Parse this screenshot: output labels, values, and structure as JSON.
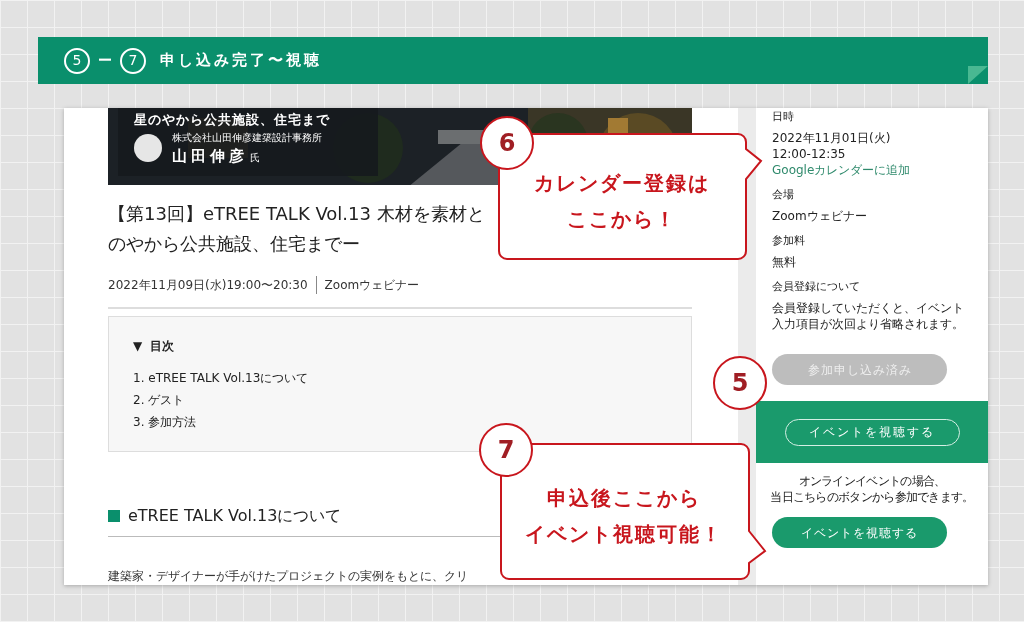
{
  "section_header": {
    "step_from": "5",
    "dash": "ー",
    "step_to": "7",
    "title": "申し込み完了〜視聴"
  },
  "hero": {
    "subtitle": "星のやから公共施設、住宅まで",
    "company": "株式会社山田伸彦建築設計事務所",
    "speaker": "山田伸彦",
    "honorific": "氏"
  },
  "event": {
    "title_lines": [
      "【第13回】eTREE TALK Vol.13 木材を素材と",
      "のやから公共施設、住宅までー"
    ],
    "date": "2022年11月09日(水)19:00〜20:30",
    "venue": "Zoomウェビナー"
  },
  "toc": {
    "toggle": "▼",
    "heading": "目次",
    "items": [
      "1. eTREE TALK Vol.13について",
      "2. ゲスト",
      "3. 参加方法"
    ]
  },
  "section_heading": "eTREE TALK Vol.13について",
  "body_text": "建築家・デザイナーが手がけたプロジェクトの実例をもとに、クリ",
  "sidebar": {
    "details": [
      {
        "label": "日時",
        "lines": [
          "2022年11月01日(火)",
          "12:00-12:35"
        ],
        "link": "Googleカレンダーに追加"
      },
      {
        "label": "会場",
        "lines": [
          "Zoomウェビナー"
        ]
      },
      {
        "label": "参加料",
        "lines": [
          "無料"
        ]
      },
      {
        "label": "会員登録について",
        "lines": [
          "会員登録していただくと、イベント",
          "入力項目が次回より省略されます。"
        ]
      }
    ],
    "applied_button": {
      "label": "参加申し込み済み",
      "disabled": true
    },
    "panel_button": "イベントを視聴する",
    "note_lines": [
      "オンラインイベントの場合、",
      "当日こちらのボタンから参加できます。"
    ],
    "watch_button": "イベントを視聴する"
  },
  "annotations": [
    {
      "kind": "bubble",
      "number": "6",
      "lines": [
        "カレンダー登録は",
        "ここから！"
      ]
    },
    {
      "kind": "badge",
      "number": "5"
    },
    {
      "kind": "bubble",
      "number": "7",
      "lines": [
        "申込後ここから",
        "イベント視聴可能！"
      ]
    }
  ]
}
